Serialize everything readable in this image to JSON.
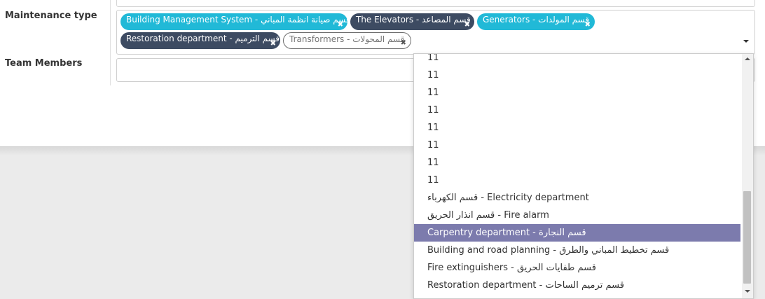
{
  "form": {
    "maintenance_type_label": "Maintenance type",
    "team_members_label": "Team Members",
    "selected_tags": [
      {
        "label": "Building Management System - قسم صيانة انظمة المباني",
        "style": "cyan"
      },
      {
        "label": "The Elevators - قسم المصاعد",
        "style": "navy"
      },
      {
        "label": "Generators - قسم المولدات",
        "style": "cyan"
      },
      {
        "label": "Restoration department - قسم الترميم",
        "style": "navy"
      },
      {
        "label": "Transformers - قسم المحولات",
        "style": "outline"
      }
    ],
    "remove_glyph": "✖"
  },
  "dropdown": {
    "options": [
      "11",
      "11",
      "11",
      "11",
      "11",
      "11",
      "11",
      "11",
      "قسم الكهرباء - Electricity department",
      "قسم انذار الحريق - Fire alarm",
      "Carpentry department - قسم النجارة",
      "Building and road planning - قسم تخطيط المباني والطرق",
      "Fire extinguishers - قسم طفايات الحريق",
      "Restoration department - قسم ترميم الساحات"
    ],
    "highlighted_index": 10
  },
  "colors": {
    "tag_cyan": "#21b9d7",
    "tag_navy": "#3d4b62",
    "highlight": "#7c7bad"
  }
}
